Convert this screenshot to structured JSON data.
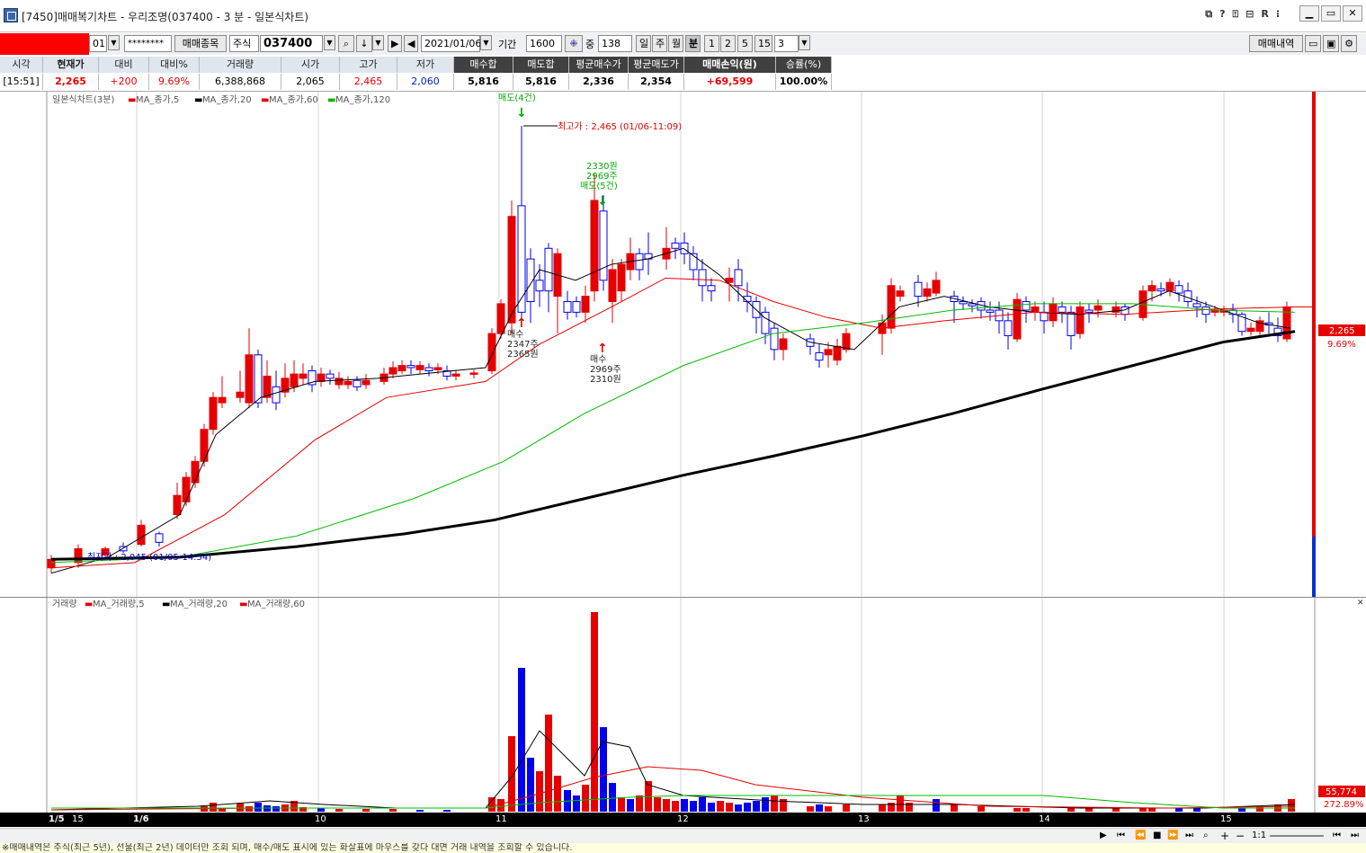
{
  "window": {
    "title": "[7450]매매복기차트 - 우리조명(037400 - 3 분 - 일본식차트)",
    "icons": [
      "⧉",
      "?",
      "⍐",
      "⊟",
      "R",
      "⁝"
    ],
    "min_label": "▁",
    "max_label": "▭",
    "close_label": "✕"
  },
  "toolbar": {
    "account_suffix": "01",
    "password_mask": "********",
    "trade_items_btn": "매매종목",
    "market_label": "주식",
    "code": "037400",
    "date": "2021/01/06",
    "period_label": "기간",
    "period_value": "1600",
    "zoom_label": "중",
    "zoom_value": "138",
    "interval_buttons": [
      "일",
      "주",
      "월",
      "분",
      "1",
      "2",
      "5",
      "15"
    ],
    "selected_interval": "분",
    "minute_value": "3",
    "trade_history_btn": "매매내역"
  },
  "info": {
    "columns": [
      {
        "h": "시각",
        "v": "[15:51]"
      },
      {
        "h": "현재가",
        "v": "2,265",
        "hb": true,
        "vc": "red",
        "vb": true
      },
      {
        "h": "대비",
        "v": "+200",
        "vc": "red"
      },
      {
        "h": "대비%",
        "v": "9.69%",
        "vc": "red"
      },
      {
        "h": "거래량",
        "v": "6,388,868"
      },
      {
        "h": "시가",
        "v": "2,065"
      },
      {
        "h": "고가",
        "v": "2,465",
        "vc": "red"
      },
      {
        "h": "저가",
        "v": "2,060",
        "vc": "blue"
      },
      {
        "h": "매수합",
        "v": "5,816",
        "dark": true,
        "vb": true
      },
      {
        "h": "매도합",
        "v": "5,816",
        "dark": true,
        "vb": true
      },
      {
        "h": "평균매수가",
        "v": "2,336",
        "dark": true,
        "vb": true
      },
      {
        "h": "평균매도가",
        "v": "2,354",
        "dark": true,
        "vb": true
      },
      {
        "h": "매매손익(원)",
        "v": "+69,599",
        "dark": true,
        "hb": true,
        "vc": "red",
        "vb": true
      },
      {
        "h": "승률(%)",
        "v": "100.00%",
        "dark": true,
        "vb": true
      }
    ]
  },
  "price_chart": {
    "legend": "일본식차트(3분)",
    "ma_labels": [
      "MA_종가,5",
      "MA_종가,20",
      "MA_종가,60",
      "MA_종가,120"
    ],
    "ma_colors": [
      "#e60000",
      "#000000",
      "#e60000",
      "#00bb00"
    ],
    "high_label": "최고가 : 2,465 (01/06-11:09)",
    "low_label": "최저가 : 2,045 (01/05-14:54)",
    "sell1": "매도(4건)",
    "sell2_lines": [
      "2330원",
      "2969주",
      "매도(5건)"
    ],
    "buy1_lines": [
      "매수",
      "2347주",
      "2365원"
    ],
    "buy2_lines": [
      "매수",
      "2969주",
      "2310원"
    ],
    "current_price": "2,265",
    "current_pct": "9.69%"
  },
  "volume_chart": {
    "legend": "거래량",
    "ma_labels": [
      "MA_거래량,5",
      "MA_거래량,20",
      "MA_거래량,60"
    ],
    "current_volume": "55,774",
    "current_pct": "272.89%"
  },
  "time_axis": [
    {
      "label": "1/5",
      "bold": true
    },
    {
      "label": "15"
    },
    {
      "label": "1/6",
      "bold": true
    },
    {
      "label": "10"
    },
    {
      "label": "11"
    },
    {
      "label": "12"
    },
    {
      "label": "13"
    },
    {
      "label": "14"
    },
    {
      "label": "15"
    }
  ],
  "scroll": {
    "ratio_label": "1:1"
  },
  "status_text": "※매매내역은 주식(최근 5년), 선물(최근 2년) 데이터만 조회 되며, 매수/매도 표시에 있는 화살표에 마우스를 갖다 대면 거래 내역을 조회할 수 있습니다."
}
